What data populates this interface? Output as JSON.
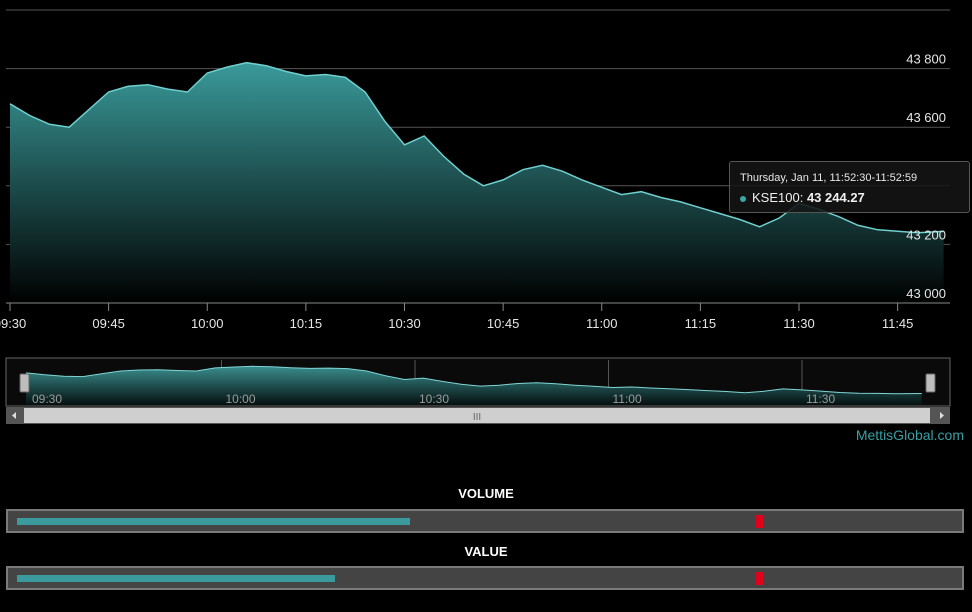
{
  "chart_data": {
    "type": "area",
    "series": [
      {
        "name": "KSE100",
        "x": [
          "09:30",
          "09:33",
          "09:36",
          "09:39",
          "09:42",
          "09:45",
          "09:48",
          "09:51",
          "09:54",
          "09:57",
          "10:00",
          "10:03",
          "10:06",
          "10:09",
          "10:12",
          "10:15",
          "10:18",
          "10:21",
          "10:24",
          "10:27",
          "10:30",
          "10:33",
          "10:36",
          "10:39",
          "10:42",
          "10:45",
          "10:48",
          "10:51",
          "10:54",
          "10:57",
          "11:00",
          "11:03",
          "11:06",
          "11:09",
          "11:12",
          "11:15",
          "11:18",
          "11:21",
          "11:24",
          "11:27",
          "11:30",
          "11:33",
          "11:36",
          "11:39",
          "11:42",
          "11:45",
          "11:48",
          "11:52"
        ],
        "values": [
          43680,
          43640,
          43610,
          43600,
          43660,
          43720,
          43740,
          43745,
          43730,
          43720,
          43785,
          43805,
          43820,
          43810,
          43790,
          43775,
          43780,
          43770,
          43720,
          43620,
          43540,
          43570,
          43500,
          43440,
          43400,
          43420,
          43455,
          43470,
          43450,
          43420,
          43395,
          43370,
          43380,
          43360,
          43345,
          43325,
          43305,
          43285,
          43260,
          43290,
          43340,
          43320,
          43295,
          43265,
          43250,
          43245,
          43240,
          43244.27
        ]
      }
    ],
    "x_ticks": [
      "09:30",
      "09:45",
      "10:00",
      "10:15",
      "10:30",
      "10:45",
      "11:00",
      "11:15",
      "11:30",
      "11:45"
    ],
    "y_ticks": [
      "43 000",
      "43 200",
      "43 600",
      "43 800"
    ],
    "ylim": [
      43000,
      44000
    ],
    "grid": true,
    "navigator_ticks": [
      "09:30",
      "10:00",
      "10:30",
      "11:00",
      "11:30"
    ],
    "colors": {
      "line": "#6fd0d0",
      "fill_top": "#3a9a9a",
      "fill_bottom": "#000000"
    }
  },
  "tooltip": {
    "date": "Thursday, Jan 11, 11:52:30-11:52:59",
    "series_label": "KSE100:",
    "value": "43 244.27"
  },
  "navigator": {
    "handle_glyph": "III"
  },
  "credit": "MettisGlobal.com",
  "volume": {
    "label": "VOLUME",
    "fill_fraction": 0.42,
    "marker_fraction": 0.79
  },
  "value": {
    "label": "VALUE",
    "fill_fraction": 0.34,
    "marker_fraction": 0.79
  },
  "colors": {
    "accent": "#3b9a9c",
    "marker": "#e3001b",
    "background": "#000000"
  }
}
